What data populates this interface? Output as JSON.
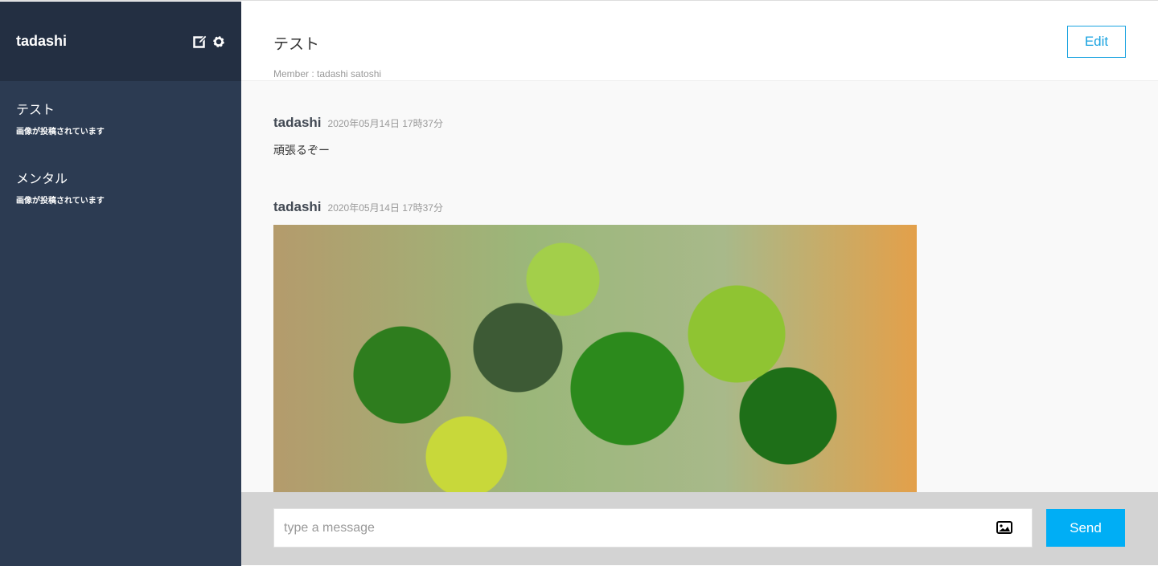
{
  "sidebar": {
    "user_name": "tadashi",
    "groups": [
      {
        "name": "テスト",
        "last_message": "画像が投稿されています"
      },
      {
        "name": "メンタル",
        "last_message": "画像が投稿されています"
      }
    ]
  },
  "header": {
    "group_name": "テスト",
    "members": "Member : tadashi satoshi",
    "edit_label": "Edit"
  },
  "messages": [
    {
      "user": "tadashi",
      "date": "2020年05月14日 17時37分",
      "text": "頑張るぞー"
    },
    {
      "user": "tadashi",
      "date": "2020年05月14日 17時37分"
    }
  ],
  "footer": {
    "placeholder": "type a message",
    "send_label": "Send"
  },
  "colors": {
    "accent": "#00aef5",
    "sidebar": "#2c3b52",
    "sidebar_header": "#232f42"
  }
}
